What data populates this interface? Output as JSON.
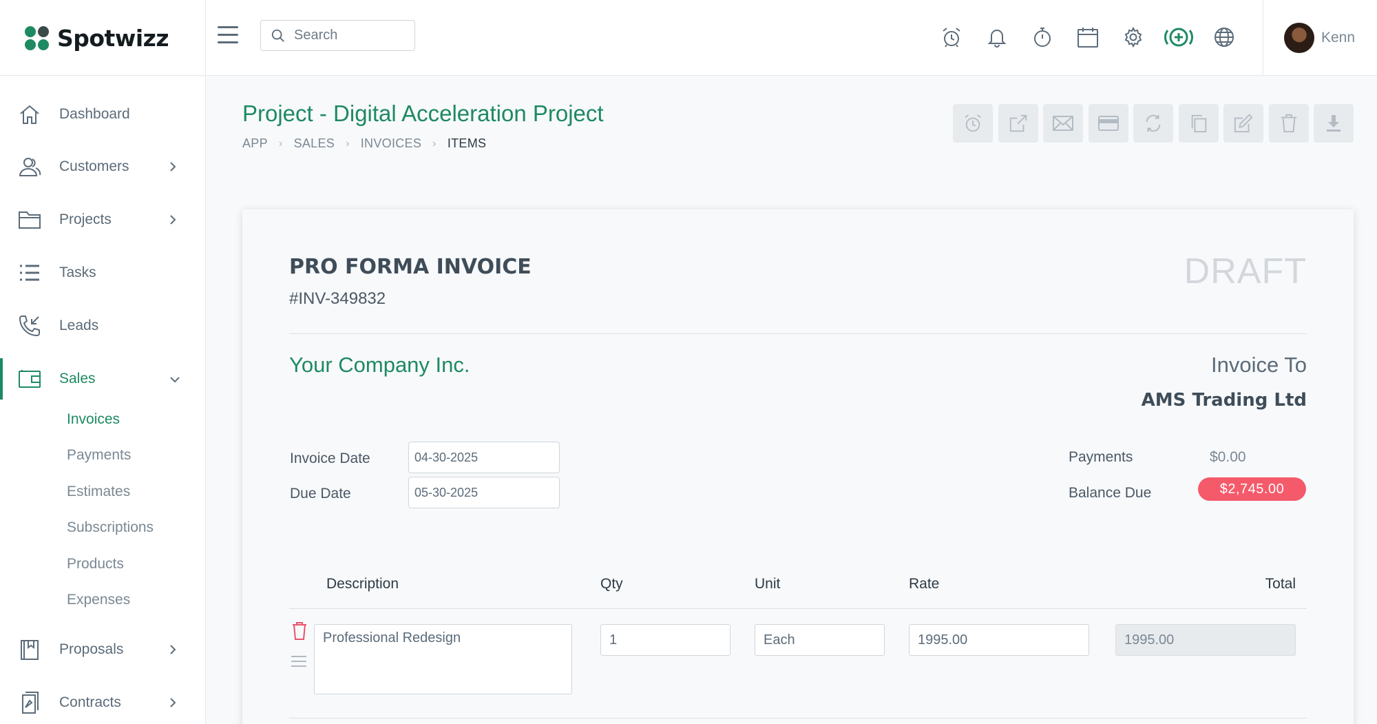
{
  "brand": {
    "name": "Spotwizz"
  },
  "search": {
    "placeholder": "Search"
  },
  "user": {
    "name": "Kenn"
  },
  "sidebar": {
    "items": [
      {
        "label": "Dashboard"
      },
      {
        "label": "Customers"
      },
      {
        "label": "Projects"
      },
      {
        "label": "Tasks"
      },
      {
        "label": "Leads"
      },
      {
        "label": "Sales"
      },
      {
        "label": "Proposals"
      },
      {
        "label": "Contracts"
      }
    ],
    "sales_sub": [
      {
        "label": "Invoices"
      },
      {
        "label": "Payments"
      },
      {
        "label": "Estimates"
      },
      {
        "label": "Subscriptions"
      },
      {
        "label": "Products"
      },
      {
        "label": "Expenses"
      }
    ]
  },
  "page": {
    "title": "Project - Digital Acceleration Project",
    "breadcrumb": [
      "APP",
      "SALES",
      "INVOICES",
      "ITEMS"
    ]
  },
  "invoice": {
    "title": "PRO FORMA INVOICE",
    "number": "#INV-349832",
    "status": "DRAFT",
    "company": "Your Company Inc.",
    "invoice_to_label": "Invoice To",
    "client": "AMS Trading Ltd",
    "invoice_date_label": "Invoice Date",
    "invoice_date": "04-30-2025",
    "due_date_label": "Due Date",
    "due_date": "05-30-2025",
    "payments_label": "Payments",
    "payments_value": "$0.00",
    "balance_label": "Balance Due",
    "balance_value": "$2,745.00",
    "columns": [
      "Description",
      "Qty",
      "Unit",
      "Rate",
      "Total"
    ],
    "items": [
      {
        "description": "Professional Redesign",
        "qty": "1",
        "unit": "Each",
        "rate": "1995.00",
        "total": "1995.00"
      }
    ]
  },
  "colors": {
    "accent": "#1e8a62",
    "danger": "#f55a6b"
  }
}
